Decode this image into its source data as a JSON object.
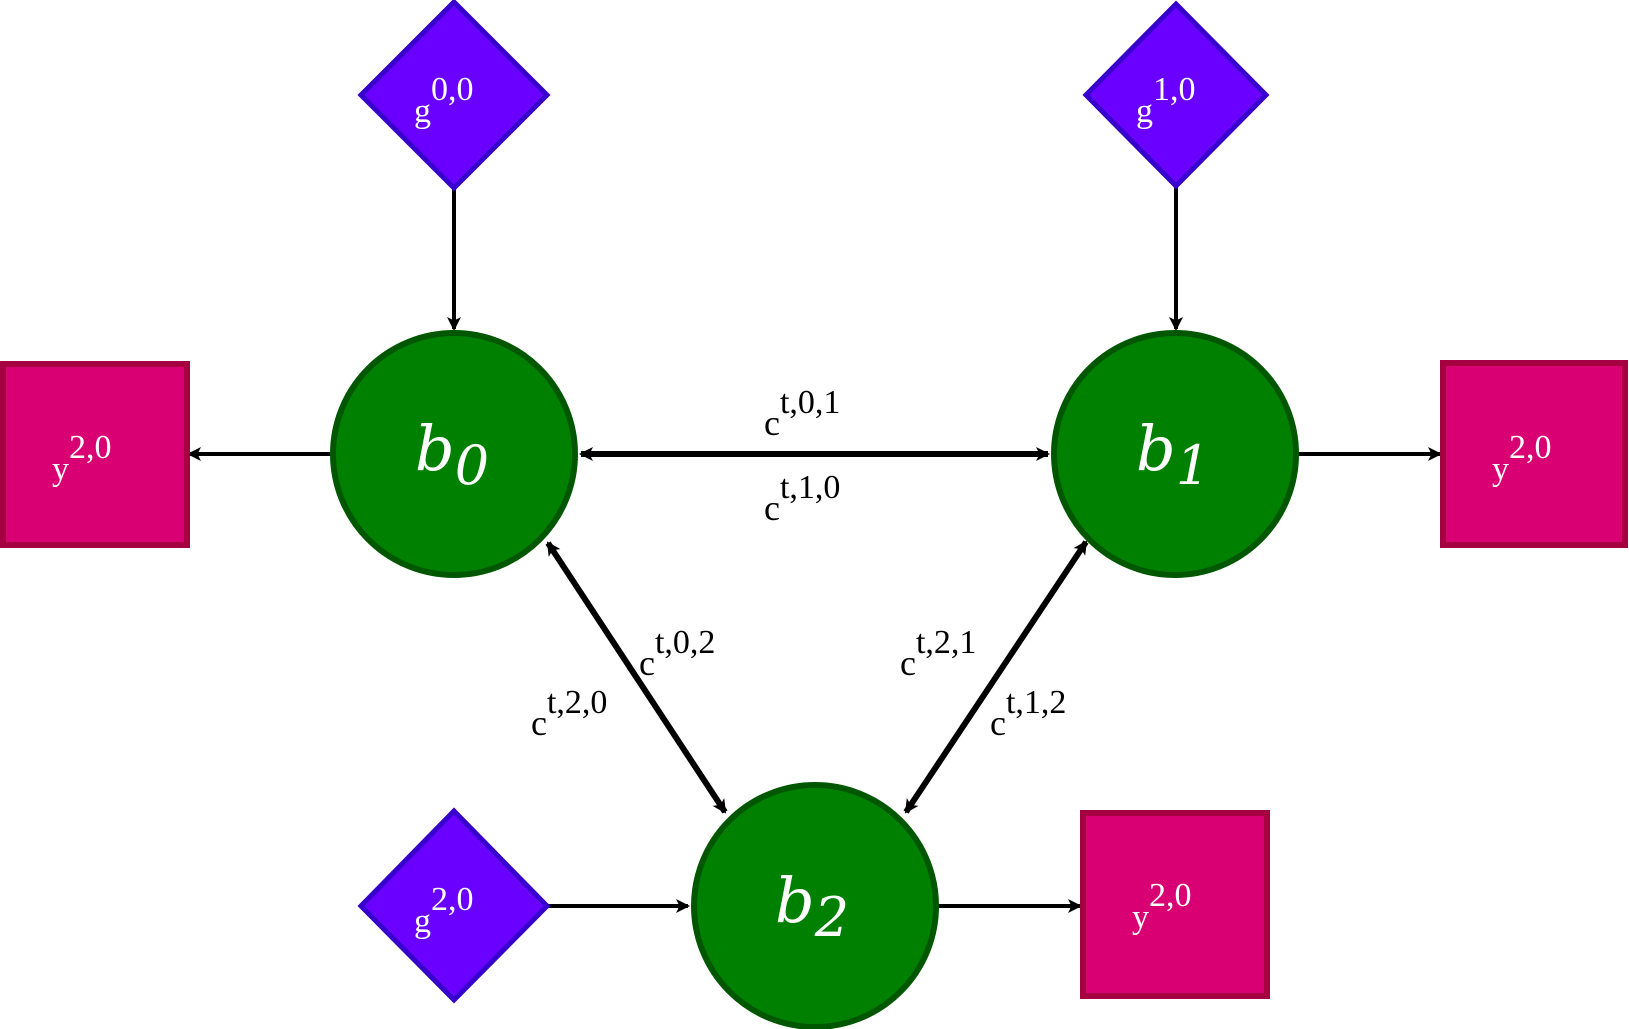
{
  "colors": {
    "bank_fill": "#008000",
    "bank_stroke": "#005700",
    "gen_fill": "#6a00ff",
    "gen_stroke": "#3700cc",
    "out_fill": "#d80073",
    "out_stroke": "#a50040",
    "edge": "#000000",
    "background": "#ffffff"
  },
  "banks": [
    {
      "id": "b0",
      "base": "b",
      "sub": "0"
    },
    {
      "id": "b1",
      "base": "b",
      "sub": "1"
    },
    {
      "id": "b2",
      "base": "b",
      "sub": "2"
    }
  ],
  "generators": [
    {
      "id": "g0",
      "base": "g",
      "sup": "0,0"
    },
    {
      "id": "g1",
      "base": "g",
      "sup": "1,0"
    },
    {
      "id": "g2",
      "base": "g",
      "sup": "2,0"
    }
  ],
  "outputs": [
    {
      "id": "y0",
      "base": "y",
      "sup": "2,0"
    },
    {
      "id": "y1",
      "base": "y",
      "sup": "2,0"
    },
    {
      "id": "y2",
      "base": "y",
      "sup": "2,0"
    }
  ],
  "flows": [
    {
      "id": "c01",
      "base": "c",
      "sup": "t,0,1"
    },
    {
      "id": "c10",
      "base": "c",
      "sup": "t,1,0"
    },
    {
      "id": "c02",
      "base": "c",
      "sup": "t,0,2"
    },
    {
      "id": "c20",
      "base": "c",
      "sup": "t,2,0"
    },
    {
      "id": "c21",
      "base": "c",
      "sup": "t,2,1"
    },
    {
      "id": "c12",
      "base": "c",
      "sup": "t,1,2"
    }
  ]
}
